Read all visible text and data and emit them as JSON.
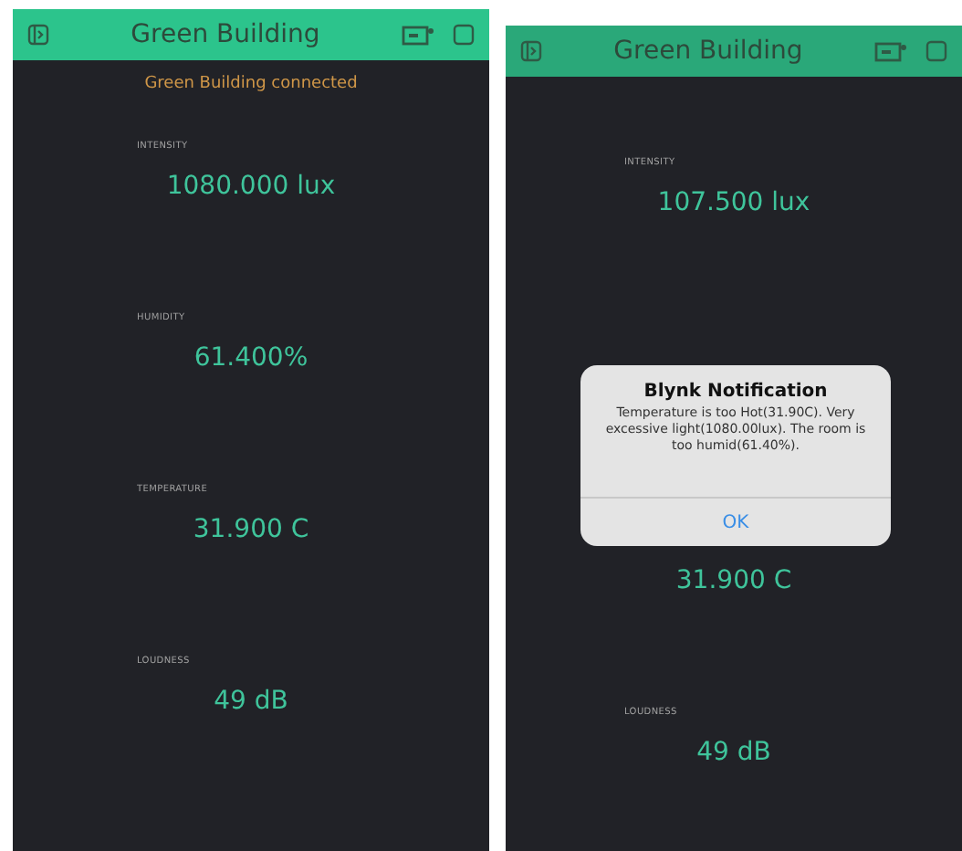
{
  "screens": [
    {
      "header": {
        "title": "Green Building"
      },
      "status_message": "Green Building connected",
      "items": [
        {
          "kind": "widget",
          "label": "INTENSITY",
          "value": "1080.000 lux"
        },
        {
          "kind": "widget",
          "label": "HUMIDITY",
          "value": "61.400%"
        },
        {
          "kind": "widget",
          "label": "TEMPERATURE",
          "value": "31.900 C"
        },
        {
          "kind": "widget",
          "label": "LOUDNESS",
          "value": "49 dB"
        }
      ]
    },
    {
      "header": {
        "title": "Green Building"
      },
      "items": [
        {
          "kind": "widget",
          "label": "INTENSITY",
          "value": "107.500 lux"
        },
        {
          "kind": "dialog",
          "title": "Blynk Notification",
          "message": "Temperature is too Hot(31.90C). Very excessive light(1080.00lux). The room is too humid(61.40%).",
          "button": "OK"
        },
        {
          "kind": "widget",
          "value": "31.900 C"
        },
        {
          "kind": "widget",
          "label": "LOUDNESS",
          "value": "49 dB"
        }
      ]
    }
  ]
}
